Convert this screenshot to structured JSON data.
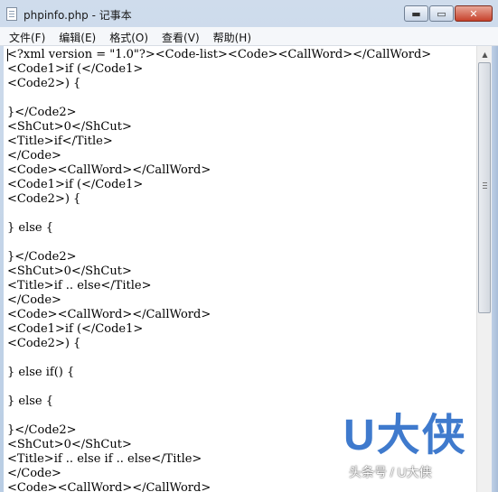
{
  "window": {
    "title": "phpinfo.php - 记事本",
    "icon": "notepad-icon",
    "buttons": {
      "minimize": "▬",
      "maximize": "▭",
      "close": "✕"
    }
  },
  "menu": {
    "items": [
      "文件(F)",
      "编辑(E)",
      "格式(O)",
      "查看(V)",
      "帮助(H)"
    ]
  },
  "editor": {
    "text": "<?xml version = \"1.0\"?><Code-list><Code><CallWord></CallWord>\n<Code1>if (</Code1>\n<Code2>) {\n\n}</Code2>\n<ShCut>0</ShCut>\n<Title>if</Title>\n</Code>\n<Code><CallWord></CallWord>\n<Code1>if (</Code1>\n<Code2>) {\n\n} else {\n\n}</Code2>\n<ShCut>0</ShCut>\n<Title>if .. else</Title>\n</Code>\n<Code><CallWord></CallWord>\n<Code1>if (</Code1>\n<Code2>) {\n\n} else if() {\n\n} else {\n\n}</Code2>\n<ShCut>0</ShCut>\n<Title>if .. else if .. else</Title>\n</Code>\n<Code><CallWord></CallWord>"
  },
  "scrollbar": {
    "up_arrow": "▲",
    "down_arrow": "▼"
  },
  "watermark": {
    "logo": "U大侠",
    "text": "头条号 / U大侠"
  }
}
